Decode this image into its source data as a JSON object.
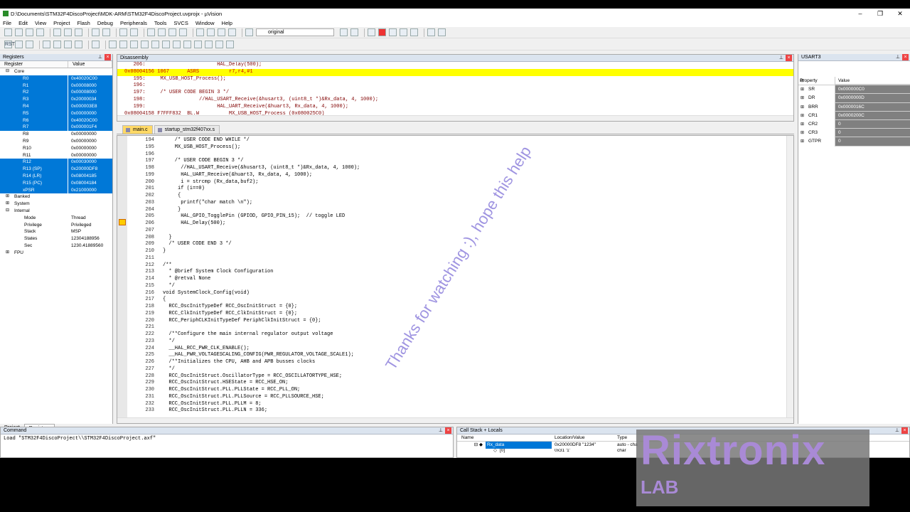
{
  "window": {
    "title": "D:\\Documents\\STM32F4DiscoProject\\MDK-ARM\\STM32F4DiscoProject.uvprojx - µVision"
  },
  "menu": [
    "File",
    "Edit",
    "View",
    "Project",
    "Flash",
    "Debug",
    "Peripherals",
    "Tools",
    "SVCS",
    "Window",
    "Help"
  ],
  "toolbar": {
    "target_combo": "original"
  },
  "registers_panel": {
    "title": "Registers",
    "col_register": "Register",
    "col_value": "Value",
    "core_label": "Core",
    "rows": [
      {
        "name": "R0",
        "value": "0x40020C00",
        "sel": true
      },
      {
        "name": "R1",
        "value": "0x00008000",
        "sel": true
      },
      {
        "name": "R2",
        "value": "0x00008000",
        "sel": true
      },
      {
        "name": "R3",
        "value": "0x20000034",
        "sel": true
      },
      {
        "name": "R4",
        "value": "0x000003E8",
        "sel": true
      },
      {
        "name": "R5",
        "value": "0x00000000",
        "sel": true
      },
      {
        "name": "R6",
        "value": "0x40020C00",
        "sel": true
      },
      {
        "name": "R7",
        "value": "0x000001F4",
        "sel": true
      },
      {
        "name": "R8",
        "value": "0x00000000",
        "sel": false
      },
      {
        "name": "R9",
        "value": "0x00000000",
        "sel": false
      },
      {
        "name": "R10",
        "value": "0x00000000",
        "sel": false
      },
      {
        "name": "R11",
        "value": "0x00000000",
        "sel": false
      },
      {
        "name": "R12",
        "value": "0x00030000",
        "sel": true
      },
      {
        "name": "R13 (SP)",
        "value": "0x20000DF8",
        "sel": true
      },
      {
        "name": "R14 (LR)",
        "value": "0x08004185",
        "sel": true
      },
      {
        "name": "R15 (PC)",
        "value": "0x08004184",
        "sel": true
      },
      {
        "name": "xPSR",
        "value": "0x21000000",
        "sel": true
      }
    ],
    "groups": [
      "Banked",
      "System",
      "Internal"
    ],
    "internal": [
      {
        "name": "Mode",
        "value": "Thread"
      },
      {
        "name": "Privilege",
        "value": "Privileged"
      },
      {
        "name": "Stack",
        "value": "MSP"
      },
      {
        "name": "States",
        "value": "12304188956"
      },
      {
        "name": "Sec",
        "value": "1230.41889560"
      }
    ],
    "fpu_label": "FPU",
    "tabs": [
      "Project",
      "Registers"
    ]
  },
  "disassembly": {
    "title": "Disassembly",
    "lines": [
      {
        "text": "   206:                        HAL_Delay(500);",
        "cur": false
      },
      {
        "text": "0x08004156 1067      ASRS          r7,r4,#1",
        "cur": true
      },
      {
        "text": "   195:     MX_USB_HOST_Process();",
        "cur": false
      },
      {
        "text": "   196:",
        "cur": false
      },
      {
        "text": "   197:     /* USER CODE BEGIN 3 */",
        "cur": false
      },
      {
        "text": "   198:                  //HAL_USART_Receive(&husart3, (uint8_t *)&Rx_data, 4, 1000);",
        "cur": false
      },
      {
        "text": "   199:                        HAL_UART_Receive(&huart3, Rx_data, 4, 1000);",
        "cur": false
      },
      {
        "text": "0x08004158 F7FFF832  BL.W          MX_USB_HOST_Process (0x080025C0)",
        "cur": false
      }
    ]
  },
  "editor": {
    "tabs": [
      "main.c",
      "startup_stm32f407xx.s"
    ],
    "lines": [
      {
        "n": "194",
        "t": "    /* USER CODE END WHILE */"
      },
      {
        "n": "195",
        "t": "    MX_USB_HOST_Process();"
      },
      {
        "n": "196",
        "t": ""
      },
      {
        "n": "197",
        "t": "    /* USER CODE BEGIN 3 */"
      },
      {
        "n": "198",
        "t": "      //HAL_USART_Receive(&husart3, (uint8_t *)&Rx_data, 4, 1000);"
      },
      {
        "n": "199",
        "t": "      HAL_UART_Receive(&huart3, Rx_data, 4, 1000);"
      },
      {
        "n": "200",
        "t": "      i = strcmp (Rx_data,buf2);"
      },
      {
        "n": "201",
        "t": "     if (i==0)"
      },
      {
        "n": "202",
        "t": "     {"
      },
      {
        "n": "203",
        "t": "      printf(\"char match \\n\");"
      },
      {
        "n": "204",
        "t": "     }"
      },
      {
        "n": "205",
        "t": "      HAL_GPIO_TogglePin (GPIOD, GPIO_PIN_15);  // toggle LED"
      },
      {
        "n": "206",
        "t": "      HAL_Delay(500);"
      },
      {
        "n": "207",
        "t": ""
      },
      {
        "n": "208",
        "t": "  }"
      },
      {
        "n": "209",
        "t": "  /* USER CODE END 3 */"
      },
      {
        "n": "210",
        "t": "}"
      },
      {
        "n": "211",
        "t": ""
      },
      {
        "n": "212",
        "t": "/**"
      },
      {
        "n": "213",
        "t": "  * @brief System Clock Configuration"
      },
      {
        "n": "214",
        "t": "  * @retval None"
      },
      {
        "n": "215",
        "t": "  */"
      },
      {
        "n": "216",
        "t": "void SystemClock_Config(void)"
      },
      {
        "n": "217",
        "t": "{"
      },
      {
        "n": "218",
        "t": "  RCC_OscInitTypeDef RCC_OscInitStruct = {0};"
      },
      {
        "n": "219",
        "t": "  RCC_ClkInitTypeDef RCC_ClkInitStruct = {0};"
      },
      {
        "n": "220",
        "t": "  RCC_PeriphCLKInitTypeDef PeriphClkInitStruct = {0};"
      },
      {
        "n": "221",
        "t": ""
      },
      {
        "n": "222",
        "t": "  /**Configure the main internal regulator output voltage"
      },
      {
        "n": "223",
        "t": "  */"
      },
      {
        "n": "224",
        "t": "  __HAL_RCC_PWR_CLK_ENABLE();"
      },
      {
        "n": "225",
        "t": "  __HAL_PWR_VOLTAGESCALING_CONFIG(PWR_REGULATOR_VOLTAGE_SCALE1);"
      },
      {
        "n": "226",
        "t": "  /**Initializes the CPU, AHB and APB busses clocks"
      },
      {
        "n": "227",
        "t": "  */"
      },
      {
        "n": "228",
        "t": "  RCC_OscInitStruct.OscillatorType = RCC_OSCILLATORTYPE_HSE;"
      },
      {
        "n": "229",
        "t": "  RCC_OscInitStruct.HSEState = RCC_HSE_ON;"
      },
      {
        "n": "230",
        "t": "  RCC_OscInitStruct.PLL.PLLState = RCC_PLL_ON;"
      },
      {
        "n": "231",
        "t": "  RCC_OscInitStruct.PLL.PLLSource = RCC_PLLSOURCE_HSE;"
      },
      {
        "n": "232",
        "t": "  RCC_OscInitStruct.PLL.PLLM = 8;"
      },
      {
        "n": "233",
        "t": "  RCC_OscInitStruct.PLL.PLLN = 336;"
      }
    ]
  },
  "usart": {
    "title": "USART3",
    "col_property": "Property",
    "col_value": "Value",
    "rows": [
      {
        "name": "SR",
        "value": "0x000000C0"
      },
      {
        "name": "DR",
        "value": "0x0000000D"
      },
      {
        "name": "BRR",
        "value": "0x0000016C"
      },
      {
        "name": "CR1",
        "value": "0x0000200C"
      },
      {
        "name": "CR2",
        "value": "0"
      },
      {
        "name": "CR3",
        "value": "0"
      },
      {
        "name": "GTPR",
        "value": "0"
      }
    ]
  },
  "command": {
    "title": "Command",
    "text": "Load \"STM32F4DiscoProject\\\\STM32F4DiscoProject.axf\""
  },
  "callstack": {
    "title": "Call Stack + Locals",
    "col_name": "Name",
    "col_loc": "Location/Value",
    "col_type": "Type",
    "row_name": "Rx_data",
    "row_value": "0x20000DF8 \"1234\"",
    "row_type": "auto - cha",
    "row2_name": "[0]",
    "row2_value": "0x31 '1'",
    "row2_type": "char"
  },
  "overlay": {
    "watermark": "Thanks for watching :), hope this help",
    "logo_big": "Rixtronix",
    "logo_small": "LAB"
  }
}
